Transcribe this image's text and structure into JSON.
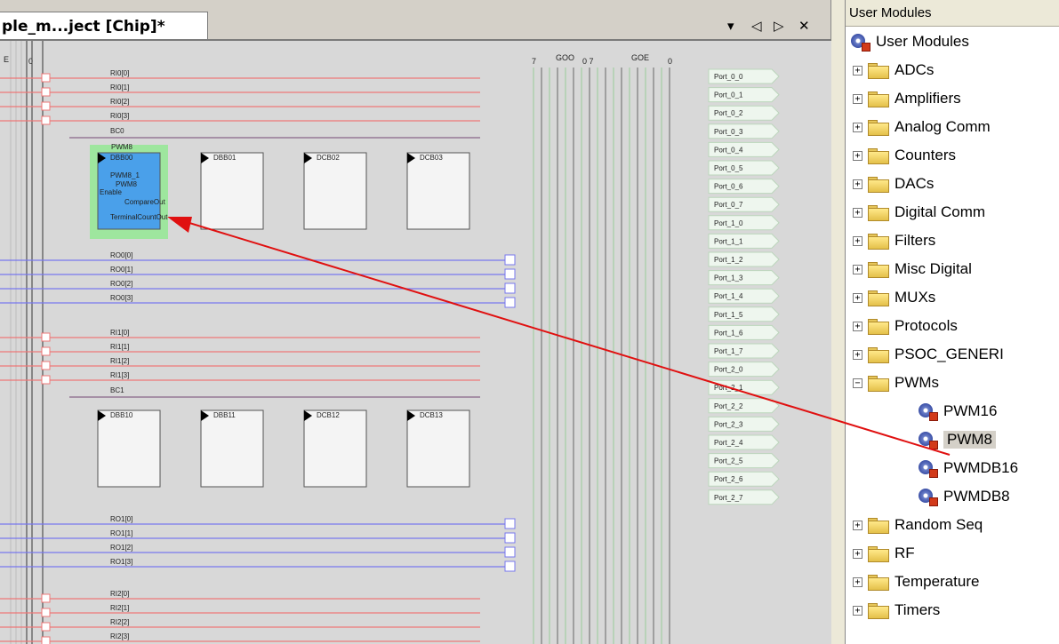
{
  "chip": {
    "tab_title": "ple_m...ject [Chip]*",
    "controls": {
      "dropdown": "▾",
      "prev": "◁",
      "next": "▷",
      "close": "✕"
    },
    "header_labels": {
      "e": "E",
      "zero": "0",
      "seven": "7",
      "goo": "GOO",
      "goo_range": "0 7",
      "goe": "GOE",
      "goe_zero": "0"
    },
    "bus_labels": {
      "ri0": [
        "RI0[0]",
        "RI0[1]",
        "RI0[2]",
        "RI0[3]"
      ],
      "bc0": "BC0",
      "ro0": [
        "RO0[0]",
        "RO0[1]",
        "RO0[2]",
        "RO0[3]"
      ],
      "ri1": [
        "RI1[0]",
        "RI1[1]",
        "RI1[2]",
        "RI1[3]"
      ],
      "bc1": "BC1",
      "ro1": [
        "RO1[0]",
        "RO1[1]",
        "RO1[2]",
        "RO1[3]"
      ],
      "ri2": [
        "RI2[0]",
        "RI2[1]",
        "RI2[2]",
        "RI2[3]"
      ]
    },
    "blocks_row0": [
      "DBB00",
      "DBB01",
      "DCB02",
      "DCB03"
    ],
    "blocks_row1": [
      "DBB10",
      "DBB11",
      "DCB12",
      "DCB13"
    ],
    "placed_module": {
      "type_label": "PWM8",
      "instance_line1": "PWM8_1",
      "instance_line2": "PWM8",
      "pin_enable": "Enable",
      "pin_compare": "CompareOut",
      "pin_terminal": "TerminalCountOut"
    },
    "port_labels": [
      "Port_0_0",
      "Port_0_1",
      "Port_0_2",
      "Port_0_3",
      "Port_0_4",
      "Port_0_5",
      "Port_0_6",
      "Port_0_7",
      "Port_1_0",
      "Port_1_1",
      "Port_1_2",
      "Port_1_3",
      "Port_1_4",
      "Port_1_5",
      "Port_1_6",
      "Port_1_7",
      "Port_2_0",
      "Port_2_1",
      "Port_2_2",
      "Port_2_3",
      "Port_2_4",
      "Port_2_5",
      "Port_2_6",
      "Port_2_7"
    ],
    "colors": {
      "ri_line": "#e77",
      "ro_line": "#77e",
      "bc_line": "#868",
      "block_selected": "#4aa0ea",
      "highlight": "#9ee69e",
      "arrow": "#e01010"
    }
  },
  "user_modules": {
    "header": "User Modules",
    "root": "User Modules",
    "folders": [
      "ADCs",
      "Amplifiers",
      "Analog Comm",
      "Counters",
      "DACs",
      "Digital Comm",
      "Filters",
      "Misc Digital",
      "MUXs",
      "Protocols",
      "PSOC_GENERI"
    ],
    "expanded_folder": "PWMs",
    "expanded_items": [
      "PWM16",
      "PWM8",
      "PWMDB16",
      "PWMDB8"
    ],
    "selected_item": "PWM8",
    "folders_after": [
      "Random Seq",
      "RF",
      "Temperature",
      "Timers"
    ]
  }
}
